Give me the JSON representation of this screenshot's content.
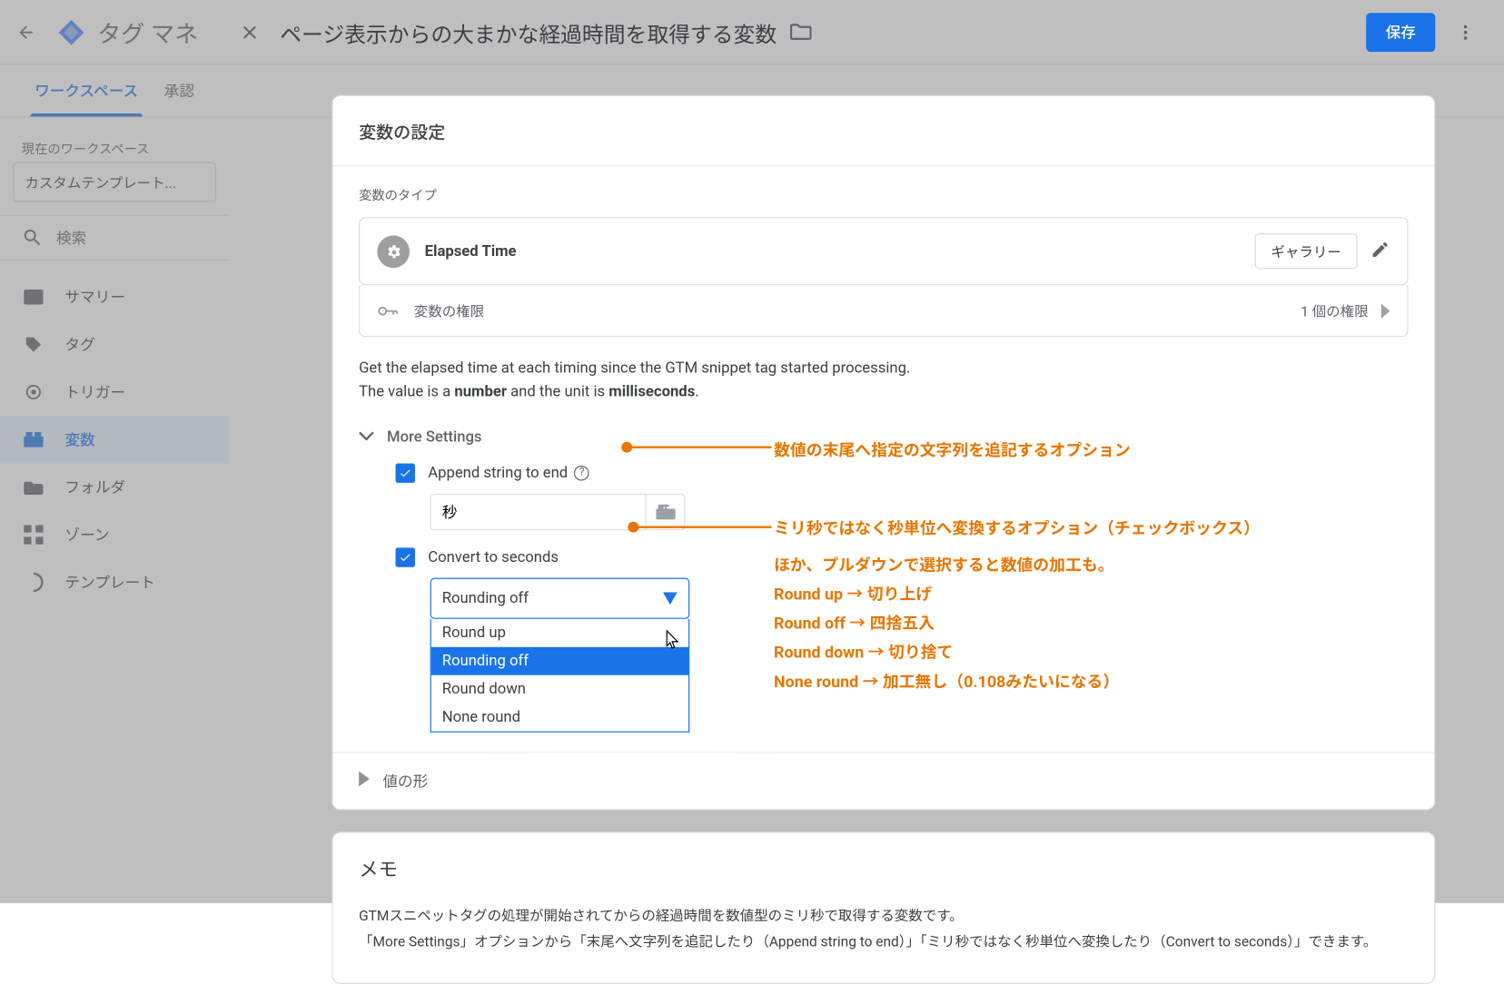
{
  "bg": {
    "title": "タグ マネ",
    "tab_workspace": "ワークスペース",
    "tab_approval": "承認",
    "ws_label": "現在のワークスペース",
    "ws_selected": "カスタムテンプレート...",
    "search": "検索",
    "nav": [
      "サマリー",
      "タグ",
      "トリガー",
      "変数",
      "フォルダ",
      "ゾーン",
      "テンプレート"
    ]
  },
  "panel": {
    "title": "ページ表示からの大まかな経過時間を取得する変数",
    "save": "保存"
  },
  "config": {
    "header": "変数の設定",
    "type_label": "変数のタイプ",
    "type_name": "Elapsed Time",
    "gallery": "ギャラリー",
    "perm_label": "変数の権限",
    "perm_count": "1 個の権限",
    "desc1_a": "Get the elapsed time at each timing since the GTM snippet tag started processing.",
    "desc2_a": "The value is a ",
    "desc2_b": "number",
    "desc2_c": " and the unit is ",
    "desc2_d": "milliseconds",
    "desc2_e": ".",
    "more_settings": "More Settings",
    "append_label": "Append string to end",
    "append_value": "秒",
    "convert_label": "Convert to seconds",
    "rounding_selected": "Rounding off",
    "rounding_options": [
      "Round up",
      "Rounding off",
      "Round down",
      "None round"
    ],
    "value_format": "値の形"
  },
  "memo": {
    "header": "メモ",
    "line1": "GTMスニペットタグの処理が開始されてからの経過時間を数値型のミリ秒で取得する変数です。",
    "line2": "「More Settings」オプションから「末尾へ文字列を追記したり（Append string to end）」「ミリ秒ではなく秒単位へ変換したり（Convert to seconds）」できます。"
  },
  "annot": {
    "a1": "数値の末尾へ指定の文字列を追記するオプション",
    "a2": "ミリ秒ではなく秒単位へ変換するオプション（チェックボックス）",
    "a3": "ほか、プルダウンで選択すると数値の加工も。",
    "a4": "Round up → 切り上げ",
    "a5": "Round off → 四捨五入",
    "a6": "Round down → 切り捨て",
    "a7": "None round → 加工無し（0.108みたいになる）"
  }
}
